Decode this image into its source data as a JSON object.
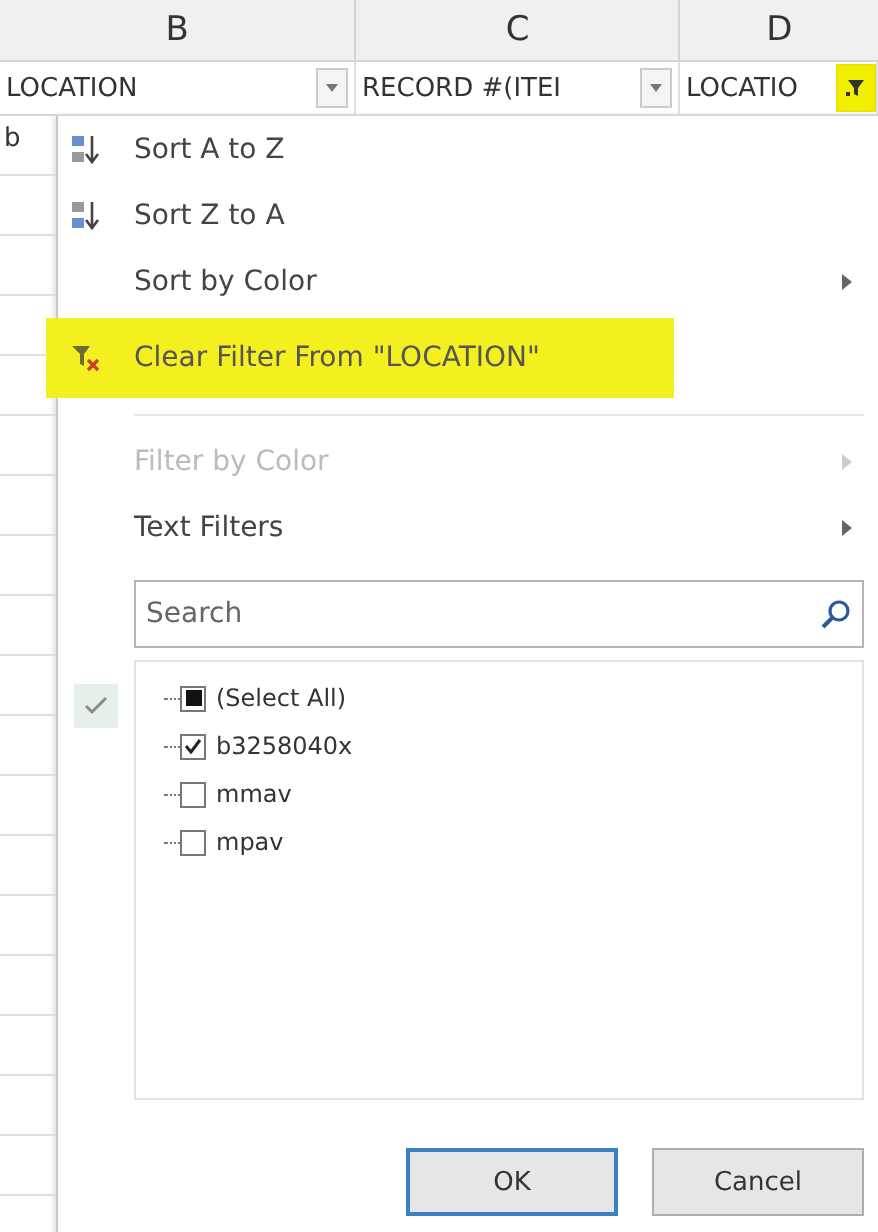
{
  "columns": [
    {
      "letter": "B",
      "header": "LOCATION",
      "kind": "dropdown",
      "highlighted": false
    },
    {
      "letter": "C",
      "header": "RECORD #(ITEI",
      "kind": "dropdown",
      "highlighted": false
    },
    {
      "letter": "D",
      "header": "LOCATIO",
      "kind": "filtered",
      "highlighted": true
    }
  ],
  "cells": [
    "b"
  ],
  "menu": {
    "items": [
      {
        "kind": "sort-asc",
        "label": "Sort A to Z",
        "submenu": false,
        "disabled": false,
        "highlighted": false
      },
      {
        "kind": "sort-desc",
        "label": "Sort Z to A",
        "submenu": false,
        "disabled": false,
        "highlighted": false
      },
      {
        "kind": "plain",
        "label": "Sort by Color",
        "submenu": true,
        "disabled": false,
        "highlighted": false
      },
      {
        "kind": "clear-filter",
        "label": "Clear Filter From \"LOCATION\"",
        "submenu": false,
        "disabled": false,
        "highlighted": true
      },
      {
        "kind": "plain",
        "label": "Filter by Color",
        "submenu": true,
        "disabled": true,
        "highlighted": false
      },
      {
        "kind": "plain",
        "label": "Text Filters",
        "submenu": true,
        "disabled": false,
        "highlighted": false
      }
    ],
    "search": {
      "placeholder": "Search"
    },
    "values": [
      {
        "label": "(Select All)",
        "checked": false,
        "indeterminate": true
      },
      {
        "label": "b3258040x",
        "checked": true,
        "indeterminate": false
      },
      {
        "label": "mmav",
        "checked": false,
        "indeterminate": false
      },
      {
        "label": "mpav",
        "checked": false,
        "indeterminate": false
      }
    ],
    "buttons": [
      {
        "label": "OK",
        "default": true
      },
      {
        "label": "Cancel",
        "default": false
      }
    ]
  }
}
